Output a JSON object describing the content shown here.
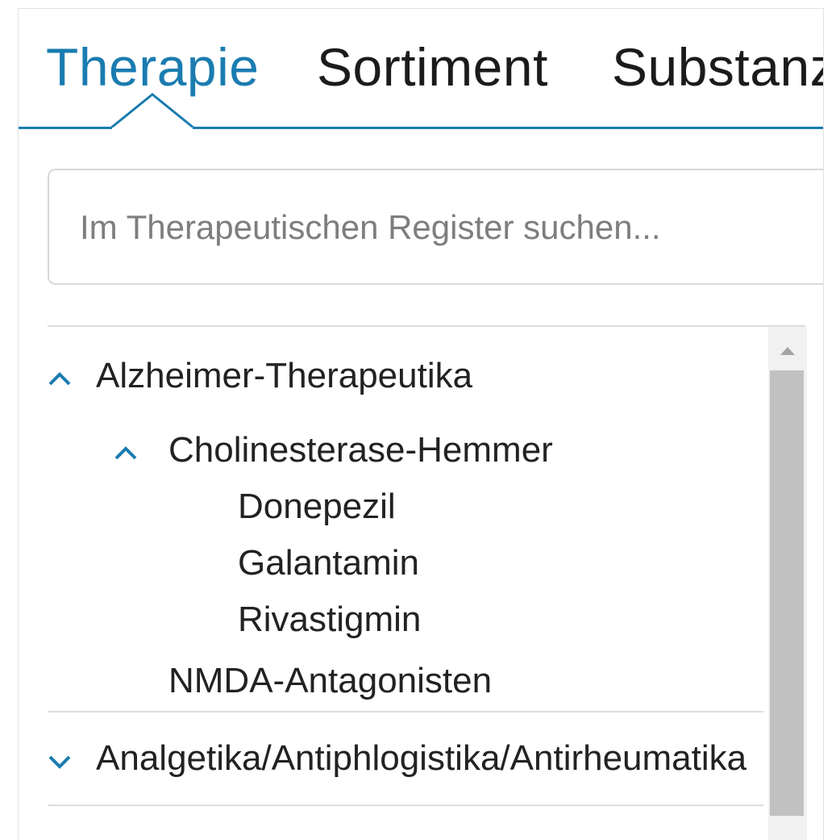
{
  "tabs": [
    {
      "label": "Therapie",
      "active": true
    },
    {
      "label": "Sortiment",
      "active": false
    },
    {
      "label": "Substanz",
      "active": false
    }
  ],
  "search": {
    "placeholder": "Im Therapeutischen Register suchen..."
  },
  "tree": [
    {
      "label": "Alzheimer-Therapeutika",
      "expanded": true
    },
    {
      "label": "Cholinesterase-Hemmer",
      "expanded": true
    },
    {
      "label": "Donepezil"
    },
    {
      "label": "Galantamin"
    },
    {
      "label": "Rivastigmin"
    },
    {
      "label": "NMDA-Antagonisten"
    },
    {
      "label": "Analgetika/Antiphlogistika/Antirheumatika",
      "expanded": false
    }
  ],
  "colors": {
    "accent": "#1a7cb0",
    "text": "#222222",
    "muted": "#7e7e7e"
  }
}
